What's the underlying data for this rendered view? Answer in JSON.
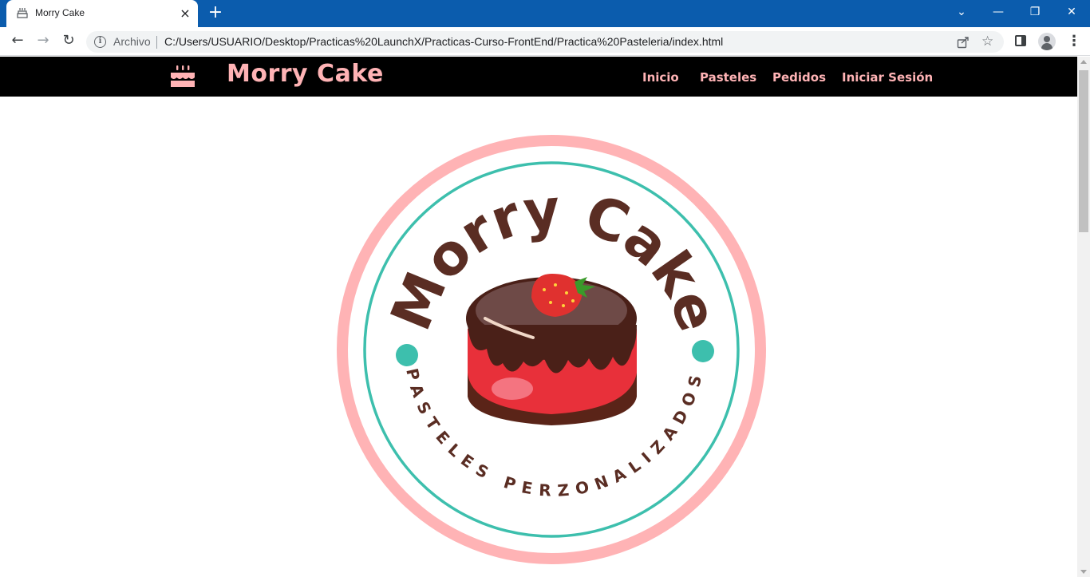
{
  "browser": {
    "tab_title": "Morry Cake",
    "new_tab_label": "+",
    "security_label": "Archivo",
    "url": "C:/Users/USUARIO/Desktop/Practicas%20LaunchX/Practicas-Curso-FrontEnd/Practica%20Pasteleria/index.html"
  },
  "site": {
    "brand": "Morry Cake",
    "nav": [
      "Inicio",
      "Pasteles",
      "Pedidos",
      "Iniciar Sesión"
    ]
  },
  "logo": {
    "title": "Morry Cake",
    "subtitle": "PASTELES PERZONALIZADOS",
    "colors": {
      "outer_ring": "#ffb3b5",
      "inner_ring": "#3dbfad",
      "text": "#5a2d23",
      "chocolate": "#4a2018",
      "cake": "#e8303a",
      "strawberry": "#e0312f"
    }
  },
  "colors": {
    "chrome": "#0b5cad",
    "navbar": "#000000",
    "accent": "#ffb3b5"
  }
}
